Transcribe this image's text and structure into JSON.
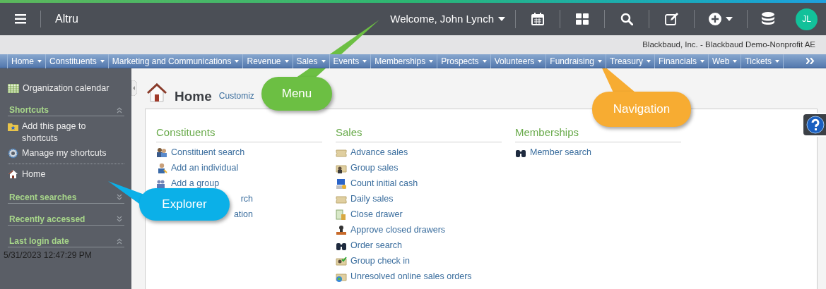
{
  "topbar": {
    "app_name": "Altru",
    "welcome": "Welcome, John Lynch",
    "avatar": "JL"
  },
  "org_line": "Blackbaud, Inc. - Blackbaud Demo-Nonprofit AE",
  "nav": [
    "Home",
    "Constituents",
    "Marketing and Communications",
    "Revenue",
    "Sales",
    "Events",
    "Memberships",
    "Prospects",
    "Volunteers",
    "Fundraising",
    "Treasury",
    "Financials",
    "Web",
    "Tickets"
  ],
  "sidebar": {
    "top_link": "Organization calendar",
    "sections": [
      {
        "title": "Shortcuts",
        "expanded": true,
        "items": [
          {
            "label": "Add this page to shortcuts",
            "kind": "add"
          },
          {
            "label": "Manage my shortcuts",
            "kind": "manage"
          },
          {
            "label": "Home",
            "kind": "page"
          }
        ]
      },
      {
        "title": "Recent searches",
        "expanded": false
      },
      {
        "title": "Recently accessed",
        "expanded": false
      },
      {
        "title": "Last login date",
        "expanded": true,
        "text": "5/31/2023 12:47:29 PM"
      }
    ]
  },
  "page": {
    "title": "Home",
    "action": "Customiz",
    "columns": [
      {
        "title": "Constituents",
        "links": [
          {
            "label": "Constituent search",
            "kind": "people"
          },
          {
            "label": "Add an individual",
            "kind": "person"
          },
          {
            "label": "Add a group",
            "kind": "group"
          },
          {
            "label": "rch",
            "kind": "covered"
          },
          {
            "label": "ation",
            "kind": "covered"
          }
        ]
      },
      {
        "title": "Sales",
        "links": [
          {
            "label": "Advance sales",
            "kind": "ticket"
          },
          {
            "label": "Group sales",
            "kind": "ticket-group"
          },
          {
            "label": "Count initial cash",
            "kind": "cash"
          },
          {
            "label": "Daily sales",
            "kind": "ticket"
          },
          {
            "label": "Close drawer",
            "kind": "drawer"
          },
          {
            "label": "Approve closed drawers",
            "kind": "stamp"
          },
          {
            "label": "Order search",
            "kind": "binoculars"
          },
          {
            "label": "Group check in",
            "kind": "check"
          },
          {
            "label": "Unresolved online sales orders",
            "kind": "globe"
          }
        ]
      },
      {
        "title": "Memberships",
        "links": [
          {
            "label": "Member search",
            "kind": "binoculars"
          }
        ]
      }
    ]
  },
  "callouts": [
    {
      "label": "Menu",
      "color": "#6cbf43"
    },
    {
      "label": "Navigation",
      "color": "#f7ac32"
    },
    {
      "label": "Explorer",
      "color": "#0bb0e8"
    }
  ]
}
